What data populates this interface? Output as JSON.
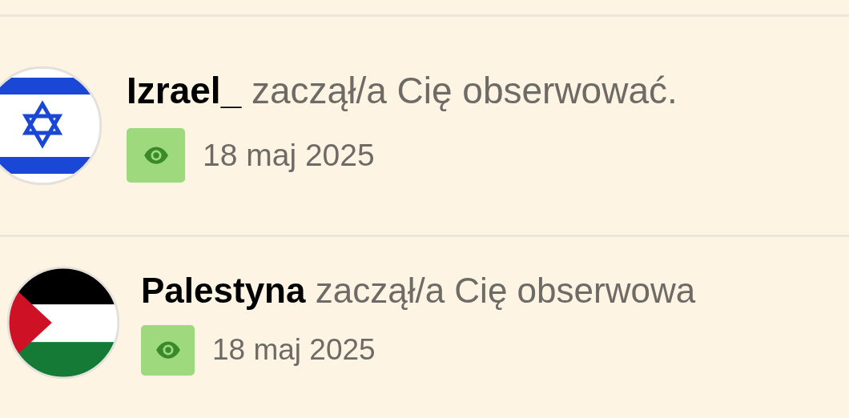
{
  "notifications": [
    {
      "kind": "star-flag",
      "user": "Izrael_",
      "message": "zaczął/a Cię obserwować.",
      "date": "18 maj 2025"
    },
    {
      "kind": "triangle-flag",
      "user": "Palestyna",
      "message": "zaczął/a Cię obserwowa",
      "date": "18 maj 2025"
    }
  ]
}
